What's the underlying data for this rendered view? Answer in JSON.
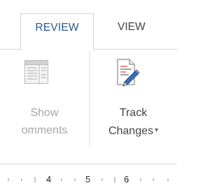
{
  "tabs": {
    "active": "REVIEW",
    "next": "VIEW"
  },
  "show_comments": {
    "line1": "Show",
    "line2": "omments",
    "icon": "show-comments-icon",
    "enabled": false
  },
  "track_changes": {
    "line1": "Track",
    "line2": "Changes",
    "dropdown": "▾",
    "icon": "track-changes-icon"
  },
  "ruler": {
    "numbers": [
      "4",
      "5",
      "6"
    ]
  },
  "colors": {
    "accent": "#2b579a",
    "disabled_text": "#a6a6a6",
    "text": "#444444"
  }
}
